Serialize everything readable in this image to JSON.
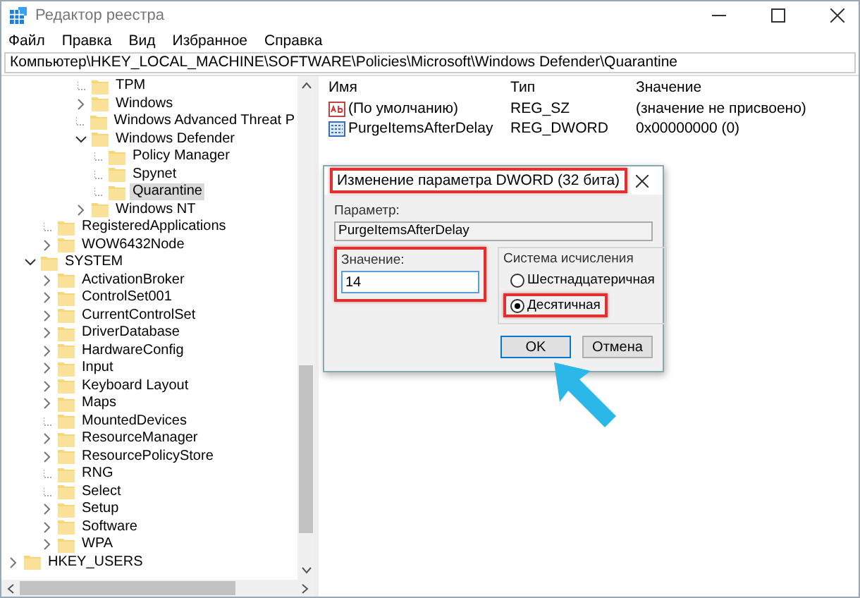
{
  "window": {
    "title": "Редактор реестра"
  },
  "menu": [
    {
      "label": "Файл"
    },
    {
      "label": "Правка"
    },
    {
      "label": "Вид"
    },
    {
      "label": "Избранное"
    },
    {
      "label": "Справка"
    }
  ],
  "address": "Компьютер\\HKEY_LOCAL_MACHINE\\SOFTWARE\\Policies\\Microsoft\\Windows Defender\\Quarantine",
  "tree": [
    {
      "children": [
        {
          "children": [
            {
              "children": [
                {
                  "children": [
                    {
                      "label": "TPM",
                      "kind": "leaf",
                      "selected": false
                    },
                    {
                      "label": "Windows",
                      "kind": "branch",
                      "expanded": false,
                      "selected": false
                    },
                    {
                      "label": "Windows Advanced Threat P",
                      "kind": "leaf",
                      "selected": false
                    },
                    {
                      "label": "Windows Defender",
                      "kind": "branch",
                      "expanded": true,
                      "selected": false,
                      "children": [
                        {
                          "label": "Policy Manager",
                          "kind": "leaf",
                          "selected": false
                        },
                        {
                          "label": "Spynet",
                          "kind": "leaf",
                          "selected": false
                        },
                        {
                          "label": "Quarantine",
                          "kind": "leaf",
                          "selected": true
                        }
                      ]
                    },
                    {
                      "label": "Windows NT",
                      "kind": "branch",
                      "expanded": false,
                      "selected": false
                    }
                  ]
                }
              ]
            },
            {
              "label": "RegisteredApplications",
              "kind": "leaf",
              "selected": false
            },
            {
              "label": "WOW6432Node",
              "kind": "branch",
              "expanded": false,
              "selected": false
            }
          ]
        },
        {
          "label": "SYSTEM",
          "kind": "branch",
          "expanded": true,
          "selected": false,
          "children": [
            {
              "label": "ActivationBroker",
              "kind": "branch",
              "expanded": false,
              "selected": false
            },
            {
              "label": "ControlSet001",
              "kind": "branch",
              "expanded": false,
              "selected": false
            },
            {
              "label": "CurrentControlSet",
              "kind": "branch",
              "expanded": false,
              "selected": false
            },
            {
              "label": "DriverDatabase",
              "kind": "branch",
              "expanded": false,
              "selected": false
            },
            {
              "label": "HardwareConfig",
              "kind": "branch",
              "expanded": false,
              "selected": false
            },
            {
              "label": "Input",
              "kind": "branch",
              "expanded": false,
              "selected": false
            },
            {
              "label": "Keyboard Layout",
              "kind": "branch",
              "expanded": false,
              "selected": false
            },
            {
              "label": "Maps",
              "kind": "branch",
              "expanded": false,
              "selected": false
            },
            {
              "label": "MountedDevices",
              "kind": "leaf",
              "selected": false
            },
            {
              "label": "ResourceManager",
              "kind": "branch",
              "expanded": false,
              "selected": false
            },
            {
              "label": "ResourcePolicyStore",
              "kind": "branch",
              "expanded": false,
              "selected": false
            },
            {
              "label": "RNG",
              "kind": "leaf",
              "selected": false
            },
            {
              "label": "Select",
              "kind": "leaf",
              "selected": false
            },
            {
              "label": "Setup",
              "kind": "branch",
              "expanded": false,
              "selected": false
            },
            {
              "label": "Software",
              "kind": "branch",
              "expanded": false,
              "selected": false
            },
            {
              "label": "WPA",
              "kind": "branch",
              "expanded": false,
              "selected": false
            }
          ]
        }
      ]
    },
    {
      "label": "HKEY_USERS",
      "kind": "branch",
      "expanded": false,
      "selected": false
    }
  ],
  "table": {
    "columns": [
      "Имя",
      "Тип",
      "Значение"
    ],
    "rows": [
      {
        "kind": "string",
        "cells": [
          "(По умолчанию)",
          "REG_SZ",
          "(значение не присвоено)"
        ]
      },
      {
        "kind": "binary",
        "cells": [
          "PurgeItemsAfterDelay",
          "REG_DWORD",
          "0x00000000 (0)"
        ]
      }
    ]
  },
  "dialog": {
    "title": "Изменение параметра DWORD (32 бита)",
    "title_highlighted": true,
    "parameter_label": "Параметр:",
    "parameter_value": "PurgeItemsAfterDelay",
    "value_label": "Значение:",
    "value": "14",
    "value_highlighted": true,
    "base_group": "Система исчисления",
    "base_options": [
      {
        "label": "Шестнадцатеричная",
        "selected": false,
        "highlighted": false
      },
      {
        "label": "Десятичная",
        "selected": true,
        "highlighted": true
      }
    ],
    "buttons": [
      {
        "label": "OK",
        "kind": "default"
      },
      {
        "label": "Отмена",
        "kind": "normal"
      }
    ]
  }
}
